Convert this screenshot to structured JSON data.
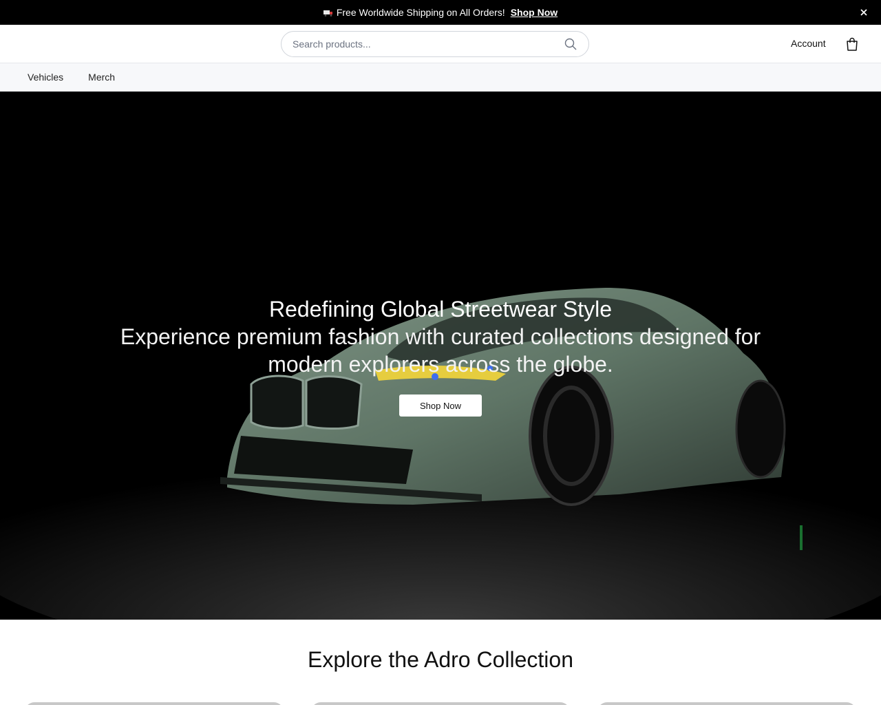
{
  "announcement": {
    "message": "Free Worldwide Shipping on All Orders!",
    "link_label": "Shop Now",
    "icon": "truck-icon"
  },
  "header": {
    "search_placeholder": "Search products...",
    "account_label": "Account",
    "cart_icon": "shopping-bag-icon"
  },
  "nav": {
    "items": [
      "Vehicles",
      "Merch"
    ]
  },
  "hero": {
    "title": "Redefining Global Streetwear Style",
    "subtitle": "Experience premium fashion with curated collections designed for modern explorers across the globe.",
    "cta_label": "Shop Now"
  },
  "collection": {
    "title": "Explore the Adro Collection"
  },
  "colors": {
    "announcement_bg": "#000000",
    "hero_bg": "#000000",
    "car_body": "#5f7566",
    "nav_bg": "#f7f8fa"
  }
}
